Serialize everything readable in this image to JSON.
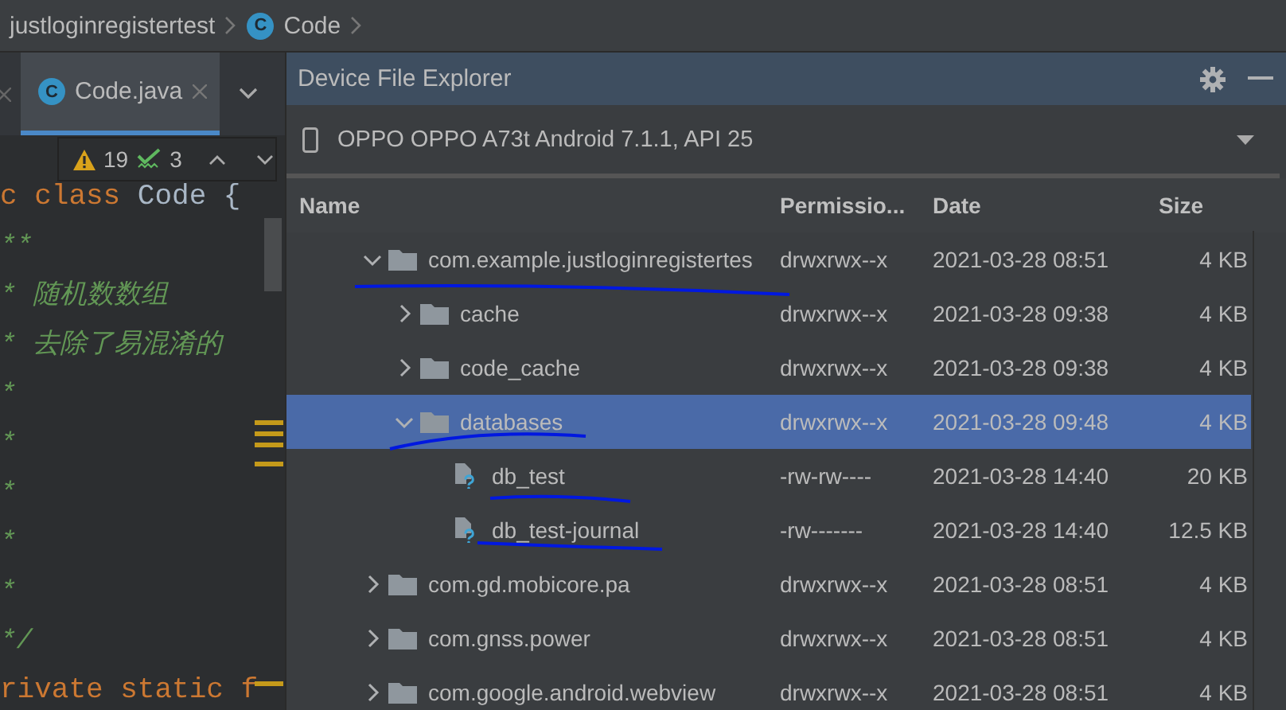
{
  "breadcrumb": {
    "project": "justloginregistertest",
    "class_icon": "C",
    "file": "Code"
  },
  "editor_tabs": [
    {
      "icon": "C",
      "label": "Code.java",
      "selected": true
    }
  ],
  "inspections": {
    "warnings": "19",
    "typos": "3"
  },
  "code_lines": [
    [
      {
        "text": "c class ",
        "kind": "keyword"
      },
      {
        "text": "Code {",
        "kind": "plain"
      }
    ],
    [
      {
        "text": "**",
        "kind": "comment"
      }
    ],
    [
      {
        "text": "*  随机数数组",
        "kind": "comment"
      }
    ],
    [
      {
        "text": "*  去除了易混淆的",
        "kind": "comment"
      }
    ],
    [
      {
        "text": "*",
        "kind": "comment"
      }
    ],
    [
      {
        "text": "*",
        "kind": "comment"
      }
    ],
    [
      {
        "text": "*",
        "kind": "comment"
      }
    ],
    [
      {
        "text": "*",
        "kind": "comment"
      }
    ],
    [
      {
        "text": "*",
        "kind": "comment"
      }
    ],
    [
      {
        "text": "*/",
        "kind": "comment"
      }
    ],
    [
      {
        "text": "rivate static f",
        "kind": "keyword"
      }
    ]
  ],
  "panel": {
    "title": "Device File Explorer",
    "device": "OPPO OPPO A73t Android 7.1.1, API 25",
    "columns": [
      "Name",
      "Permissio...",
      "Date",
      "Size"
    ],
    "rows": [
      {
        "name": "com.example.justloginregistertes",
        "kind": "folder",
        "expanded": true,
        "selected": false,
        "permissions": "drwxrwx--x",
        "date": "2021-03-28 08:51",
        "size": "4 KB",
        "children": [
          {
            "name": "cache",
            "kind": "folder",
            "expanded": false,
            "selected": false,
            "permissions": "drwxrwx--x",
            "date": "2021-03-28 09:38",
            "size": "4 KB"
          },
          {
            "name": "code_cache",
            "kind": "folder",
            "expanded": false,
            "selected": false,
            "permissions": "drwxrwx--x",
            "date": "2021-03-28 09:38",
            "size": "4 KB"
          },
          {
            "name": "databases",
            "kind": "folder",
            "expanded": true,
            "selected": true,
            "permissions": "drwxrwx--x",
            "date": "2021-03-28 09:48",
            "size": "4 KB",
            "children": [
              {
                "name": "db_test",
                "kind": "file",
                "selected": false,
                "permissions": "-rw-rw----",
                "date": "2021-03-28 14:40",
                "size": "20 KB"
              },
              {
                "name": "db_test-journal",
                "kind": "file",
                "selected": false,
                "permissions": "-rw-------",
                "date": "2021-03-28 14:40",
                "size": "12.5 KB"
              }
            ]
          }
        ]
      },
      {
        "name": "com.gd.mobicore.pa",
        "kind": "folder",
        "expanded": false,
        "selected": false,
        "permissions": "drwxrwx--x",
        "date": "2021-03-28 08:51",
        "size": "4 KB"
      },
      {
        "name": "com.gnss.power",
        "kind": "folder",
        "expanded": false,
        "selected": false,
        "permissions": "drwxrwx--x",
        "date": "2021-03-28 08:51",
        "size": "4 KB"
      },
      {
        "name": "com.google.android.webview",
        "kind": "folder",
        "expanded": false,
        "selected": false,
        "permissions": "drwxrwx--x",
        "date": "2021-03-28 08:51",
        "size": "4 KB"
      }
    ]
  }
}
